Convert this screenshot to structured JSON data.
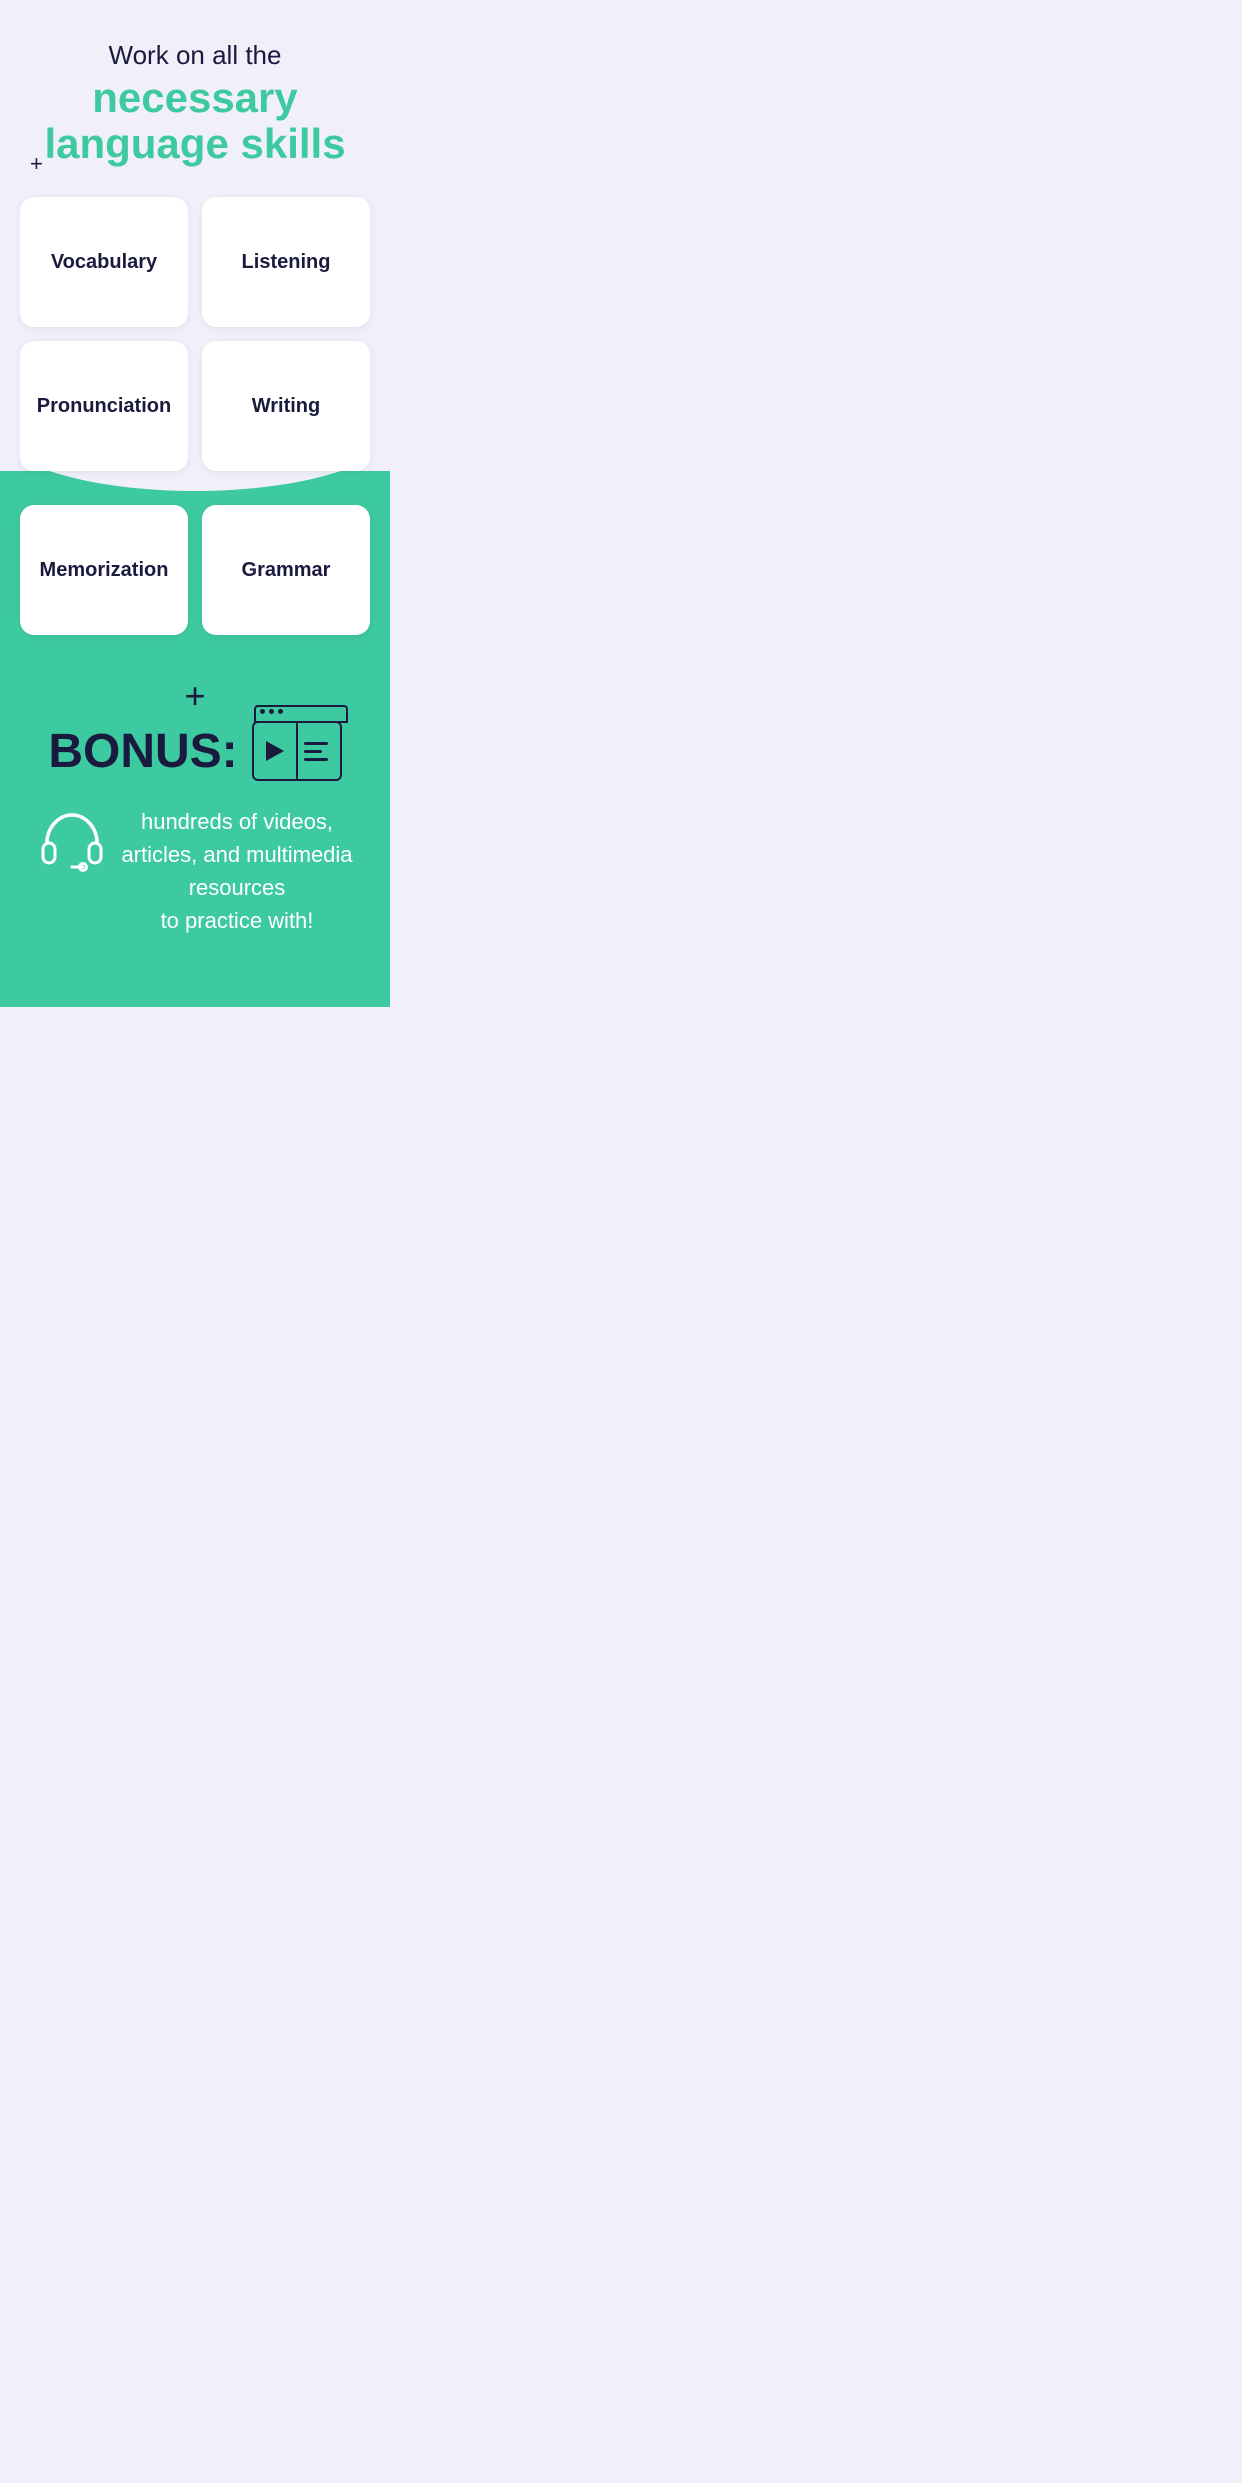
{
  "header": {
    "subtitle": "Work on all the",
    "title_line1": "necessary",
    "title_line2": "language skills",
    "plus_symbol": "+"
  },
  "skills": [
    {
      "id": "vocabulary",
      "label": "Vocabulary"
    },
    {
      "id": "listening",
      "label": "Listening"
    },
    {
      "id": "pronunciation",
      "label": "Pronunciation"
    },
    {
      "id": "writing",
      "label": "Writing"
    },
    {
      "id": "memorization",
      "label": "Memorization"
    },
    {
      "id": "grammar",
      "label": "Grammar"
    }
  ],
  "bonus": {
    "plus": "+",
    "label": "BONUS:",
    "description": "hundreds of videos,\narticles, and multimedia\nresources\nto practice with!"
  },
  "colors": {
    "background": "#f0effa",
    "green": "#3ecaa0",
    "dark": "#1a1a3e",
    "white": "#ffffff"
  }
}
